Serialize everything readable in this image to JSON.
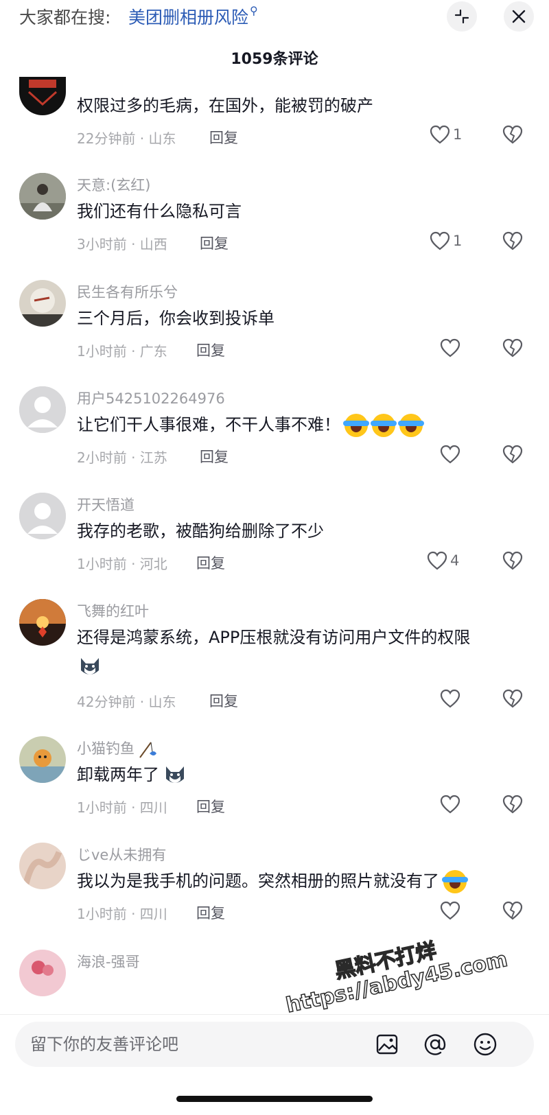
{
  "header": {
    "search_prefix": "大家都在搜:",
    "search_term": "美团删相册风险",
    "comment_count_title": "1059条评论"
  },
  "comments": [
    {
      "username": "",
      "text": "权限过多的毛病，在国外，能被罚的破产",
      "time_location": "22分钟前 · 山东",
      "reply": "回复",
      "likes": "1"
    },
    {
      "username": "天意:(玄红)",
      "text": "我们还有什么隐私可言",
      "time_location": "3小时前 · 山西",
      "reply": "回复",
      "likes": "1"
    },
    {
      "username": "民生各有所乐兮",
      "text": "三个月后，你会收到投诉单",
      "time_location": "1小时前 · 广东",
      "reply": "回复",
      "likes": ""
    },
    {
      "username": "用户5425102264976",
      "text": "让它们干人事很难，不干人事不难！",
      "time_location": "2小时前 · 江苏",
      "reply": "回复",
      "likes": ""
    },
    {
      "username": "开天悟道",
      "text": "我存的老歌，被酷狗给删除了不少",
      "time_location": "1小时前 · 河北",
      "reply": "回复",
      "likes": "4"
    },
    {
      "username": "飞舞的红叶",
      "text": "还得是鸿蒙系统，APP压根就没有访问用户文件的权限",
      "time_location": "42分钟前 · 山东",
      "reply": "回复",
      "likes": ""
    },
    {
      "username": "小猫钓鱼",
      "text": "卸载两年了",
      "time_location": "1小时前 · 四川",
      "reply": "回复",
      "likes": ""
    },
    {
      "username": "じve从未拥有",
      "text": "我以为是我手机的问题。突然相册的照片就没有了",
      "time_location": "1小时前 · 四川",
      "reply": "回复",
      "likes": ""
    },
    {
      "username": "海浪-强哥",
      "text": "",
      "time_location": "",
      "reply": "",
      "likes": ""
    }
  ],
  "input": {
    "placeholder": "留下你的友善评论吧"
  },
  "watermark": {
    "line1": "黑料不打烊",
    "line2": "https://abdy45.com"
  },
  "icons": {
    "search": "search-icon",
    "minimize": "minimize-icon",
    "close": "close-icon",
    "like": "heart-icon",
    "dislike": "broken-heart-icon",
    "image": "image-icon",
    "mention": "at-icon",
    "emoji": "emoji-icon"
  },
  "colors": {
    "link": "#2b5bb5",
    "text": "#161823",
    "meta": "#a6a7ab"
  }
}
